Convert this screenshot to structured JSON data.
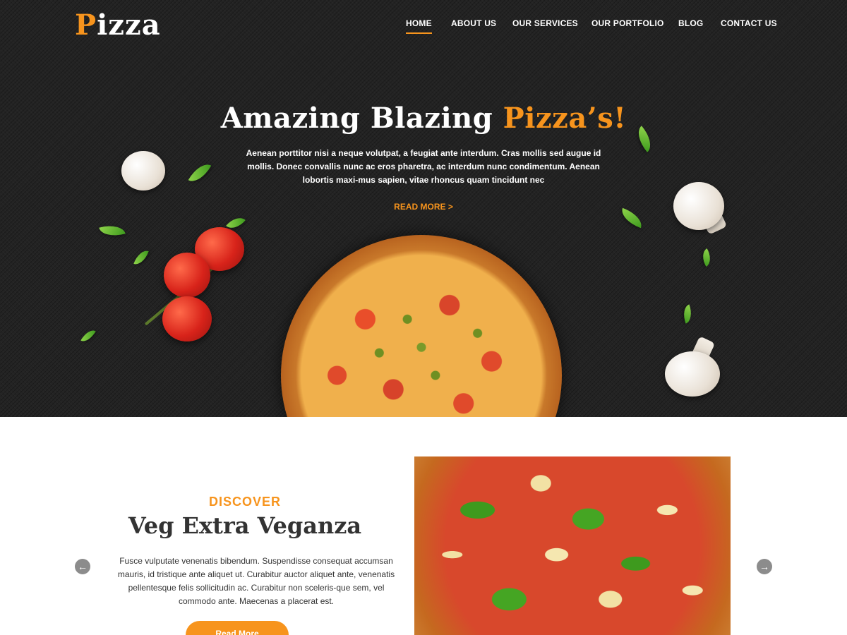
{
  "header": {
    "logo_first": "P",
    "logo_rest": "izza",
    "nav": [
      "HOME",
      "ABOUT US",
      "OUR SERVICES",
      "OUR PORTFOLIO",
      "BLOG",
      "CONTACT US"
    ],
    "active_nav": "HOME"
  },
  "hero": {
    "title_main": "Amazing Blazing ",
    "title_accent": "Pizza’s!",
    "text": "Aenean porttitor nisi a neque volutpat, a feugiat ante interdum. Cras mollis sed augue id mollis. Donec convallis nunc ac eros pharetra, ac interdum nunc condimentum. Aenean lobortis maxi-mus sapien, vitae rhoncus quam tincidunt nec",
    "read_more": "READ MORE >"
  },
  "slider": {
    "label": "DISCOVER",
    "title": "Veg Extra Veganza",
    "text": "Fusce vulputate venenatis bibendum. Suspendisse consequat accumsan mauris, id tristique ante aliquet ut. Curabitur auctor aliquet ante, venenatis pellentesque felis sollicitudin ac. Curabitur non sceleris-que sem, vel commodo ante. Maecenas a placerat est.",
    "button": "Read More",
    "prev_icon": "arrow-left-icon",
    "next_icon": "arrow-right-icon"
  },
  "colors": {
    "accent": "#f7941d",
    "hero_bg": "#232323",
    "text_dark": "#333333"
  }
}
